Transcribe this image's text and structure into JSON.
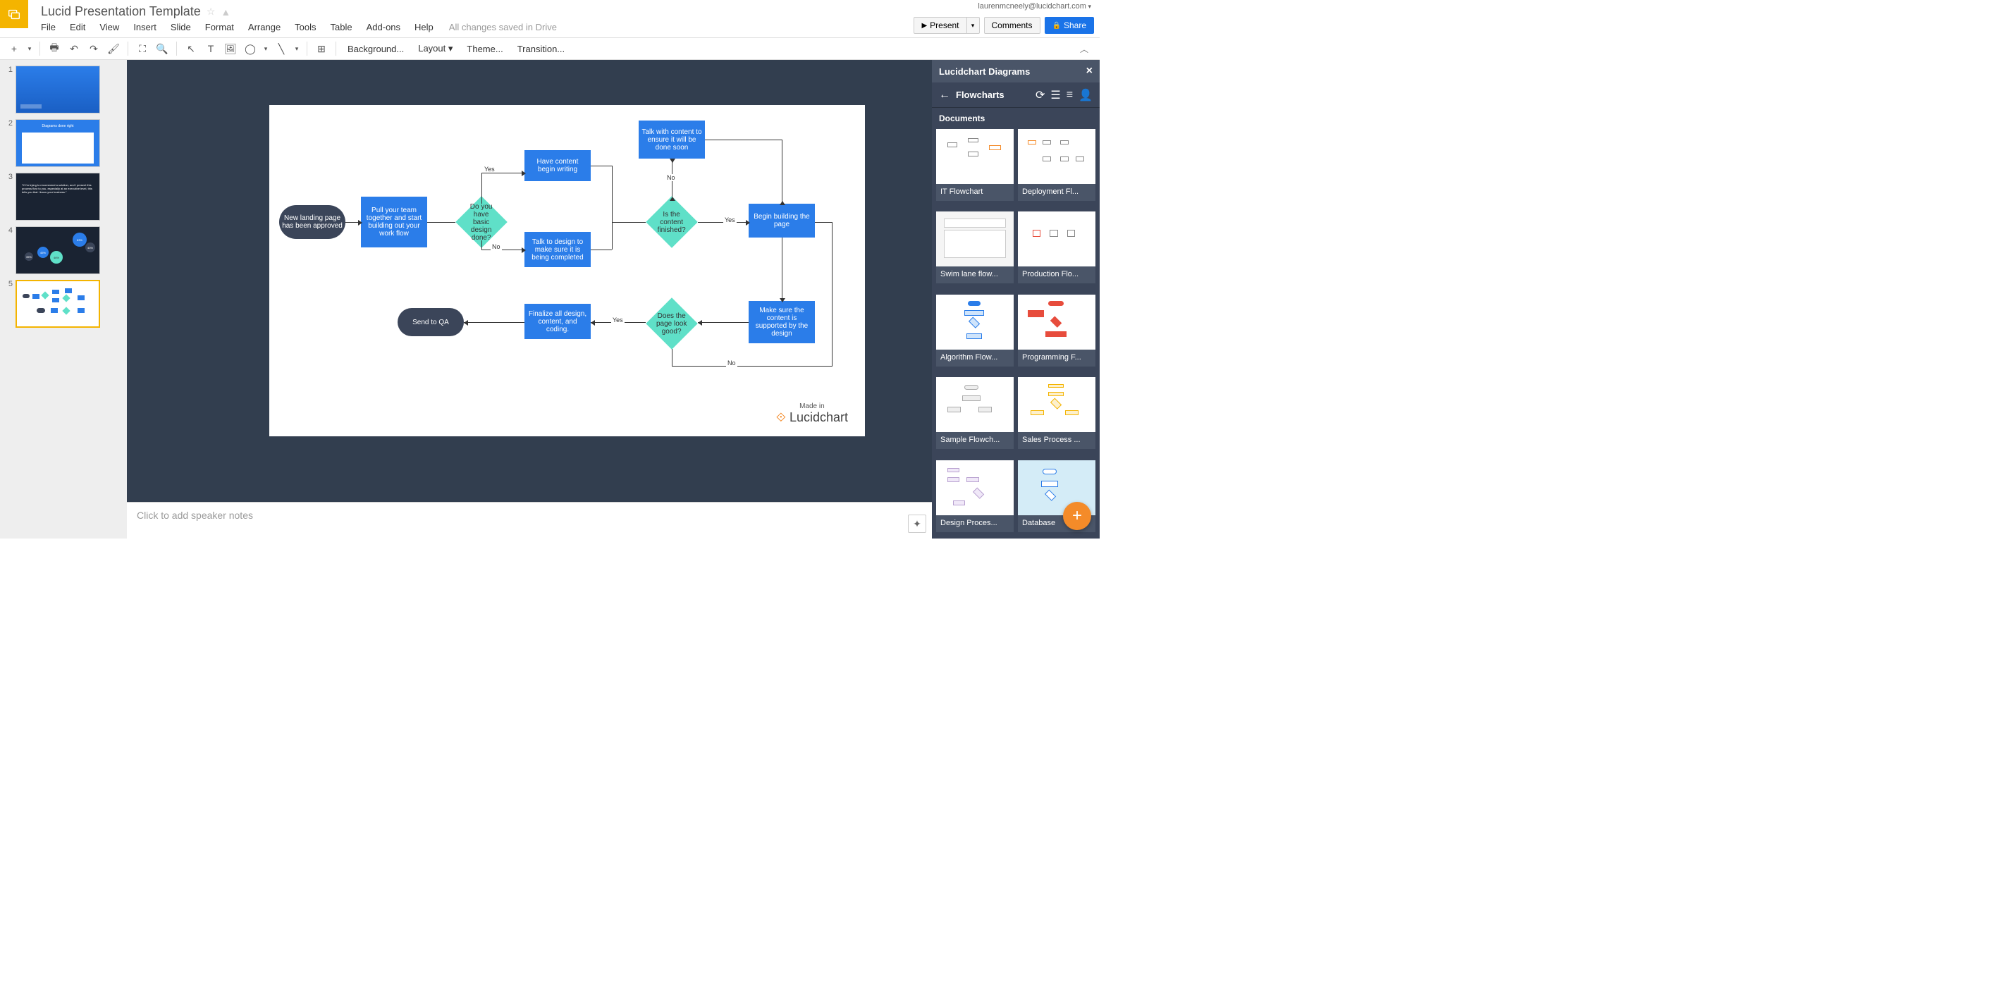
{
  "app": {
    "title": "Lucid Presentation Template",
    "user_email": "laurenmcneely@lucidchart.com",
    "save_status": "All changes saved in Drive"
  },
  "menus": [
    "File",
    "Edit",
    "View",
    "Insert",
    "Slide",
    "Format",
    "Arrange",
    "Tools",
    "Table",
    "Add-ons",
    "Help"
  ],
  "header_buttons": {
    "present": "Present",
    "comments": "Comments",
    "share": "Share"
  },
  "toolbar_text": [
    "Background...",
    "Layout",
    "Theme...",
    "Transition..."
  ],
  "filmstrip": {
    "slides": [
      {
        "num": "1"
      },
      {
        "num": "2",
        "title": "Diagrams done right"
      },
      {
        "num": "3",
        "quote": "\"If I'm trying to recommend a solution, and I present this process flow to you, especially at an executive level, this tells you that I know your business.\""
      },
      {
        "num": "4",
        "values": [
          "63%",
          "43%",
          "45%",
          "46%",
          "37%",
          "35%"
        ]
      },
      {
        "num": "5"
      }
    ],
    "selected": 5
  },
  "flowchart": {
    "nodes": {
      "start": "New landing page has been approved",
      "pull_team": "Pull your team together and start building out your work flow",
      "basic_design": "Do you have basic design done?",
      "have_content": "Have content begin writing",
      "talk_design": "Talk to design to make sure it is being completed",
      "talk_content": "Talk with content to ensure it will be done soon",
      "content_finished": "Is the content finished?",
      "begin_build": "Begin building the page",
      "supported": "Make sure the content is supported by the design",
      "look_good": "Does the page look good?",
      "finalize": "Finalize all design, content, and coding.",
      "send_qa": "Send to QA"
    },
    "labels": {
      "yes": "Yes",
      "no": "No"
    },
    "footer": {
      "made_in": "Made in",
      "brand": "Lucidchart"
    }
  },
  "speaker_notes_placeholder": "Click to add speaker notes",
  "panel": {
    "title": "Lucidchart Diagrams",
    "nav_title": "Flowcharts",
    "section": "Documents",
    "docs": [
      "IT Flowchart",
      "Deployment Fl...",
      "Swim lane flow...",
      "Production Flo...",
      "Algorithm Flow...",
      "Programming F...",
      "Sample Flowch...",
      "Sales Process ...",
      "Design Proces...",
      "Database"
    ]
  }
}
